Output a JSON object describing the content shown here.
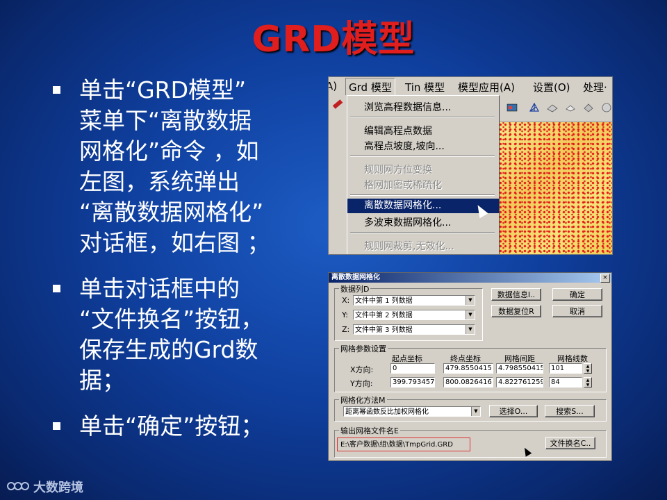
{
  "slide": {
    "title": "GRD模型",
    "bullets": [
      "单击“GRD模型”\n菜单下“离散数据\n网格化”命令 ，如\n左图，系统弹出\n“离散数据网格化”\n对话框，如右图 ；",
      "单击对话框中的\n“文件换名”按钮，\n保存生成的Grd数\n据；",
      "单击“确定”按钮；"
    ],
    "logo_text": "大数跨境"
  },
  "menu_screenshot": {
    "menubar": [
      "A)",
      "Grd 模型",
      "Tin 模型",
      "模型应用(A)",
      "设置(O)",
      "处理·"
    ],
    "dropdown_items": [
      {
        "label": "浏览高程数据信息...",
        "state": "normal"
      },
      {
        "label": "编辑高程点数据",
        "state": "normal"
      },
      {
        "label": "高程点坡度,坡向...",
        "state": "normal"
      },
      {
        "label": "规则网方位变换",
        "state": "disabled"
      },
      {
        "label": "格网加密或稀疏化",
        "state": "disabled"
      },
      {
        "label": "离散数据网格化...",
        "state": "selected"
      },
      {
        "label": "多波束数据网格化...",
        "state": "normal"
      },
      {
        "label": "规则网裁剪,无效化...",
        "state": "disabled"
      }
    ],
    "toolbar_icons": [
      "map-icon",
      "triangle-net-icon",
      "surface-icon",
      "solid-icon",
      "surface2-icon"
    ]
  },
  "dialog": {
    "title": "离散数据网格化",
    "close_label": "×",
    "data_column": {
      "label": "数据列D",
      "x_label": "X:",
      "x_value": "文件中第 1 列数据",
      "y_label": "Y:",
      "y_value": "文件中第 2 列数据",
      "z_label": "Z:",
      "z_value": "文件中第 3 列数据"
    },
    "buttons": {
      "data_info": "数据信息I..",
      "ok": "确定",
      "data_reset": "数据复位R",
      "cancel": "取消",
      "select": "选择O...",
      "search": "搜索S...",
      "rename": "文件换名C.."
    },
    "grid_params": {
      "label": "网格参数设置",
      "headers": [
        "起点坐标",
        "终点坐标",
        "网格间距",
        "网格线数"
      ],
      "x_label": "X方向:",
      "x_values": [
        "0",
        "479.8550415",
        "4.798550415",
        "101"
      ],
      "y_label": "Y方向:",
      "y_values": [
        "399.7934570",
        "800.0826416",
        "4.822761259",
        "84"
      ]
    },
    "method": {
      "label": "网格化方法M",
      "value": "距离幂函数反比加权网格化"
    },
    "output": {
      "label": "输出网格文件名E",
      "value": "E:\\客户数据\\组\\数据\\TmpGrid.GRD"
    }
  }
}
